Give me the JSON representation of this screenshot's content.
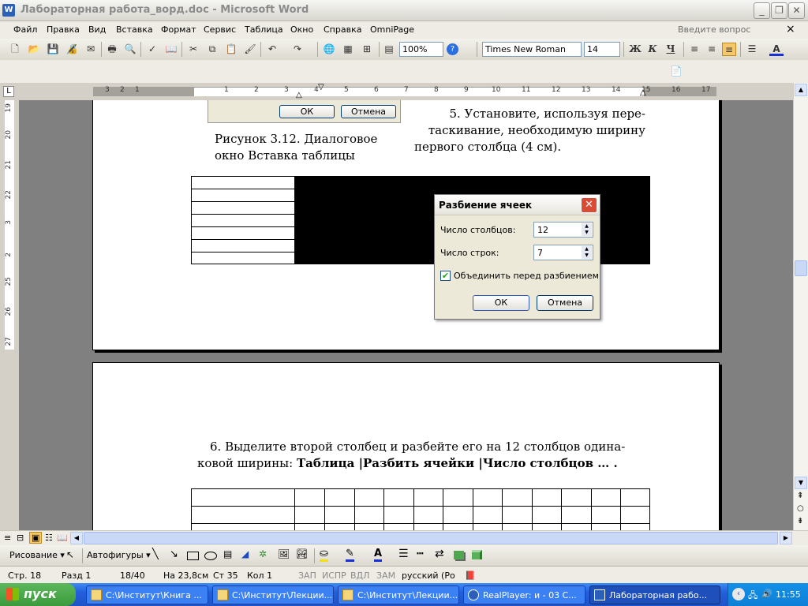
{
  "window": {
    "title": "Лабораторная работа_ворд.doc - Microsoft Word",
    "minimize": "_",
    "restore": "❐",
    "close": "✕"
  },
  "menu": {
    "items": [
      "Файл",
      "Правка",
      "Вид",
      "Вставка",
      "Формат",
      "Сервис",
      "Таблица",
      "Окно",
      "Справка",
      "OmniPage"
    ],
    "help_placeholder": "Введите вопрос",
    "close": "×"
  },
  "toolbar": {
    "zoom": "100%",
    "font": "Times New Roman",
    "size": "14",
    "bold": "Ж",
    "italic": "К",
    "underline": "Ч"
  },
  "ruler": {
    "numbers": [
      "3",
      "2",
      "1",
      "1",
      "2",
      "3",
      "4",
      "5",
      "6",
      "7",
      "8",
      "9",
      "10",
      "11",
      "12",
      "13",
      "14",
      "15",
      "16",
      "17"
    ]
  },
  "vruler": {
    "numbers": [
      "19",
      "20",
      "21",
      "22",
      "3",
      "2",
      "25",
      "26",
      "27"
    ]
  },
  "document": {
    "fig_ok": "ОК",
    "fig_cancel": "Отмена",
    "caption1": "Рисунок 3.12. Диалоговое",
    "caption2": "окно Вставка таблицы",
    "step5_l1": "5.   Установите, используя пере-",
    "step5_l2": "таскивание, необходимую ширину",
    "step5_l3": "первого столбца (4 см).",
    "step6_l1": "6.    Выделите второй столбец и разбейте его на 12 столбцов одина-",
    "step6_l2": "ковой ширины: ",
    "step6_bold": "Таблица |Разбить ячейки |Число столбцов … ."
  },
  "dialog": {
    "title": "Разбиение ячеек",
    "cols_label": "Число столбцов:",
    "cols_value": "12",
    "rows_label": "Число строк:",
    "rows_value": "7",
    "merge_label": "Объединить перед разбиением",
    "ok": "ОК",
    "cancel": "Отмена"
  },
  "drawbar": {
    "draw": "Рисование",
    "autoshapes": "Автофигуры"
  },
  "status": {
    "page": "Стр. 18",
    "section": "Разд 1",
    "pages": "18/40",
    "at": "На 23,8см",
    "line": "Ст 35",
    "col": "Кол 1",
    "rec": "ЗАП",
    "trk": "ИСПР",
    "ext": "ВДЛ",
    "ovr": "ЗАМ",
    "lang": "русский (Ро"
  },
  "taskbar": {
    "start": "пуск",
    "tasks": [
      "C:\\Институт\\Книга ...",
      "C:\\Институт\\Лекции...",
      "C:\\Институт\\Лекции...",
      "RealPlayer: и - 03  C...",
      "Лабораторная рабо..."
    ],
    "time": "11:55"
  }
}
